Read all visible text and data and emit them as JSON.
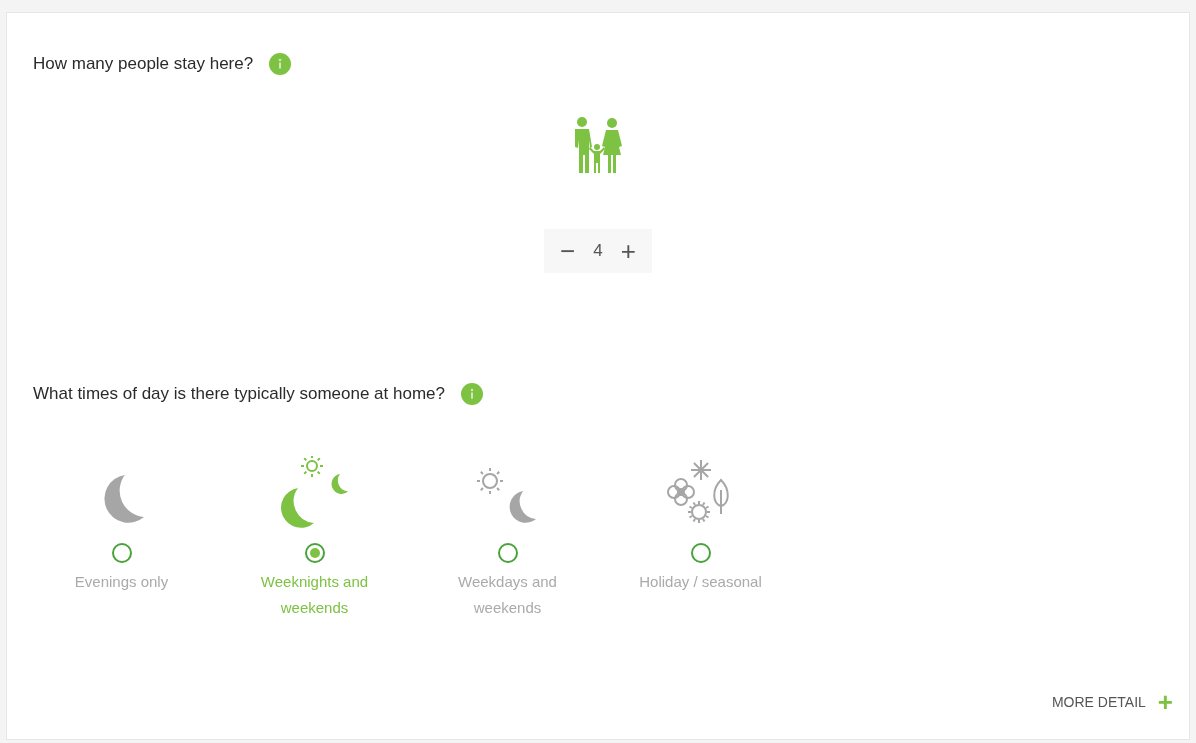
{
  "questions": [
    {
      "text": "How many people stay here?",
      "kind": "counter",
      "minus": "−",
      "value": "4",
      "plus": "+"
    },
    {
      "text": "What times of day is there typically someone at home?",
      "kind": "choice",
      "options": [
        {
          "label": "Evenings only",
          "kind": "night",
          "selected": false
        },
        {
          "label": "Weeknights and weekends",
          "kind": "mixed",
          "selected": true
        },
        {
          "label": "Weekdays and weekends",
          "kind": "day",
          "selected": false
        },
        {
          "label": "Holiday / seasonal",
          "kind": "seasonal",
          "selected": false
        }
      ]
    }
  ],
  "more_detail": {
    "label": "MORE DETAIL",
    "icon": "+"
  }
}
